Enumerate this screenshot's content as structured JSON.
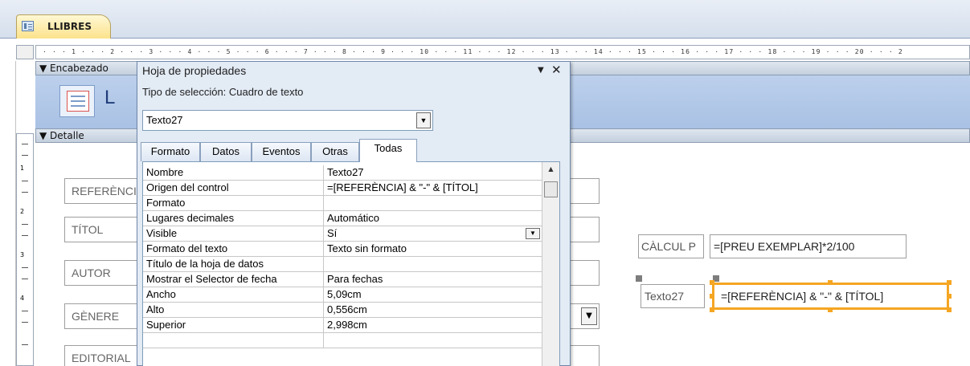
{
  "document_tab": {
    "label": "LLIBRES"
  },
  "ruler": {
    "text": "· · · 1 · · · 2 · · · 3 · · · 4 · · · 5 · · · 6 · · · 7 · · · 8 · · · 9 · · · 10 · · · 11 · · · 12 · · · 13 · · · 14 · · · 15 · · · 16 · · · 17 · · · 18 · · · 19 · · · 20 · · · 2"
  },
  "vertical_ruler": [
    "1",
    "2",
    "3",
    "4"
  ],
  "sections": {
    "header_label": "Encabezado",
    "header_text": "L",
    "detail_label": "Detalle"
  },
  "form_labels": {
    "referencia": "REFERÈNCIA",
    "titol": "TÍTOL",
    "autor": "AUTOR",
    "genere": "GÈNERE",
    "editorial": "EDITORIAL"
  },
  "calc_control": {
    "label": "CÀLCUL P",
    "expression": "=[PREU EXEMPLAR]*2/100"
  },
  "selected_control": {
    "label": "Texto27",
    "expression": "=[REFERÈNCIA] & \"-\" & [TÍTOL]"
  },
  "property_sheet": {
    "title": "Hoja de propiedades",
    "selection_type": "Tipo de selección:  Cuadro de texto",
    "object_name": "Texto27",
    "tabs": [
      "Formato",
      "Datos",
      "Eventos",
      "Otras",
      "Todas"
    ],
    "active_tab": "Todas",
    "rows": [
      {
        "key": "Nombre",
        "value": "Texto27"
      },
      {
        "key": "Origen del control",
        "value": "=[REFERÈNCIA] & \"-\" & [TÍTOL]"
      },
      {
        "key": "Formato",
        "value": ""
      },
      {
        "key": "Lugares decimales",
        "value": "Automático"
      },
      {
        "key": "Visible",
        "value": "Sí"
      },
      {
        "key": "Formato del texto",
        "value": "Texto sin formato"
      },
      {
        "key": "Título de la hoja de datos",
        "value": ""
      },
      {
        "key": "Mostrar el Selector de fecha",
        "value": "Para fechas"
      },
      {
        "key": "Ancho",
        "value": "5,09cm"
      },
      {
        "key": "Alto",
        "value": "0,556cm"
      },
      {
        "key": "Superior",
        "value": "2,998cm"
      }
    ]
  },
  "icons": {
    "tab_icon": "form-icon",
    "dropdown": "chevron-down-icon",
    "close": "close-icon",
    "pin": "menu-arrow-icon"
  },
  "colors": {
    "selection_orange": "#f5a623",
    "header_blue": "#a9c1e4",
    "tab_gold": "#fbe28b"
  }
}
